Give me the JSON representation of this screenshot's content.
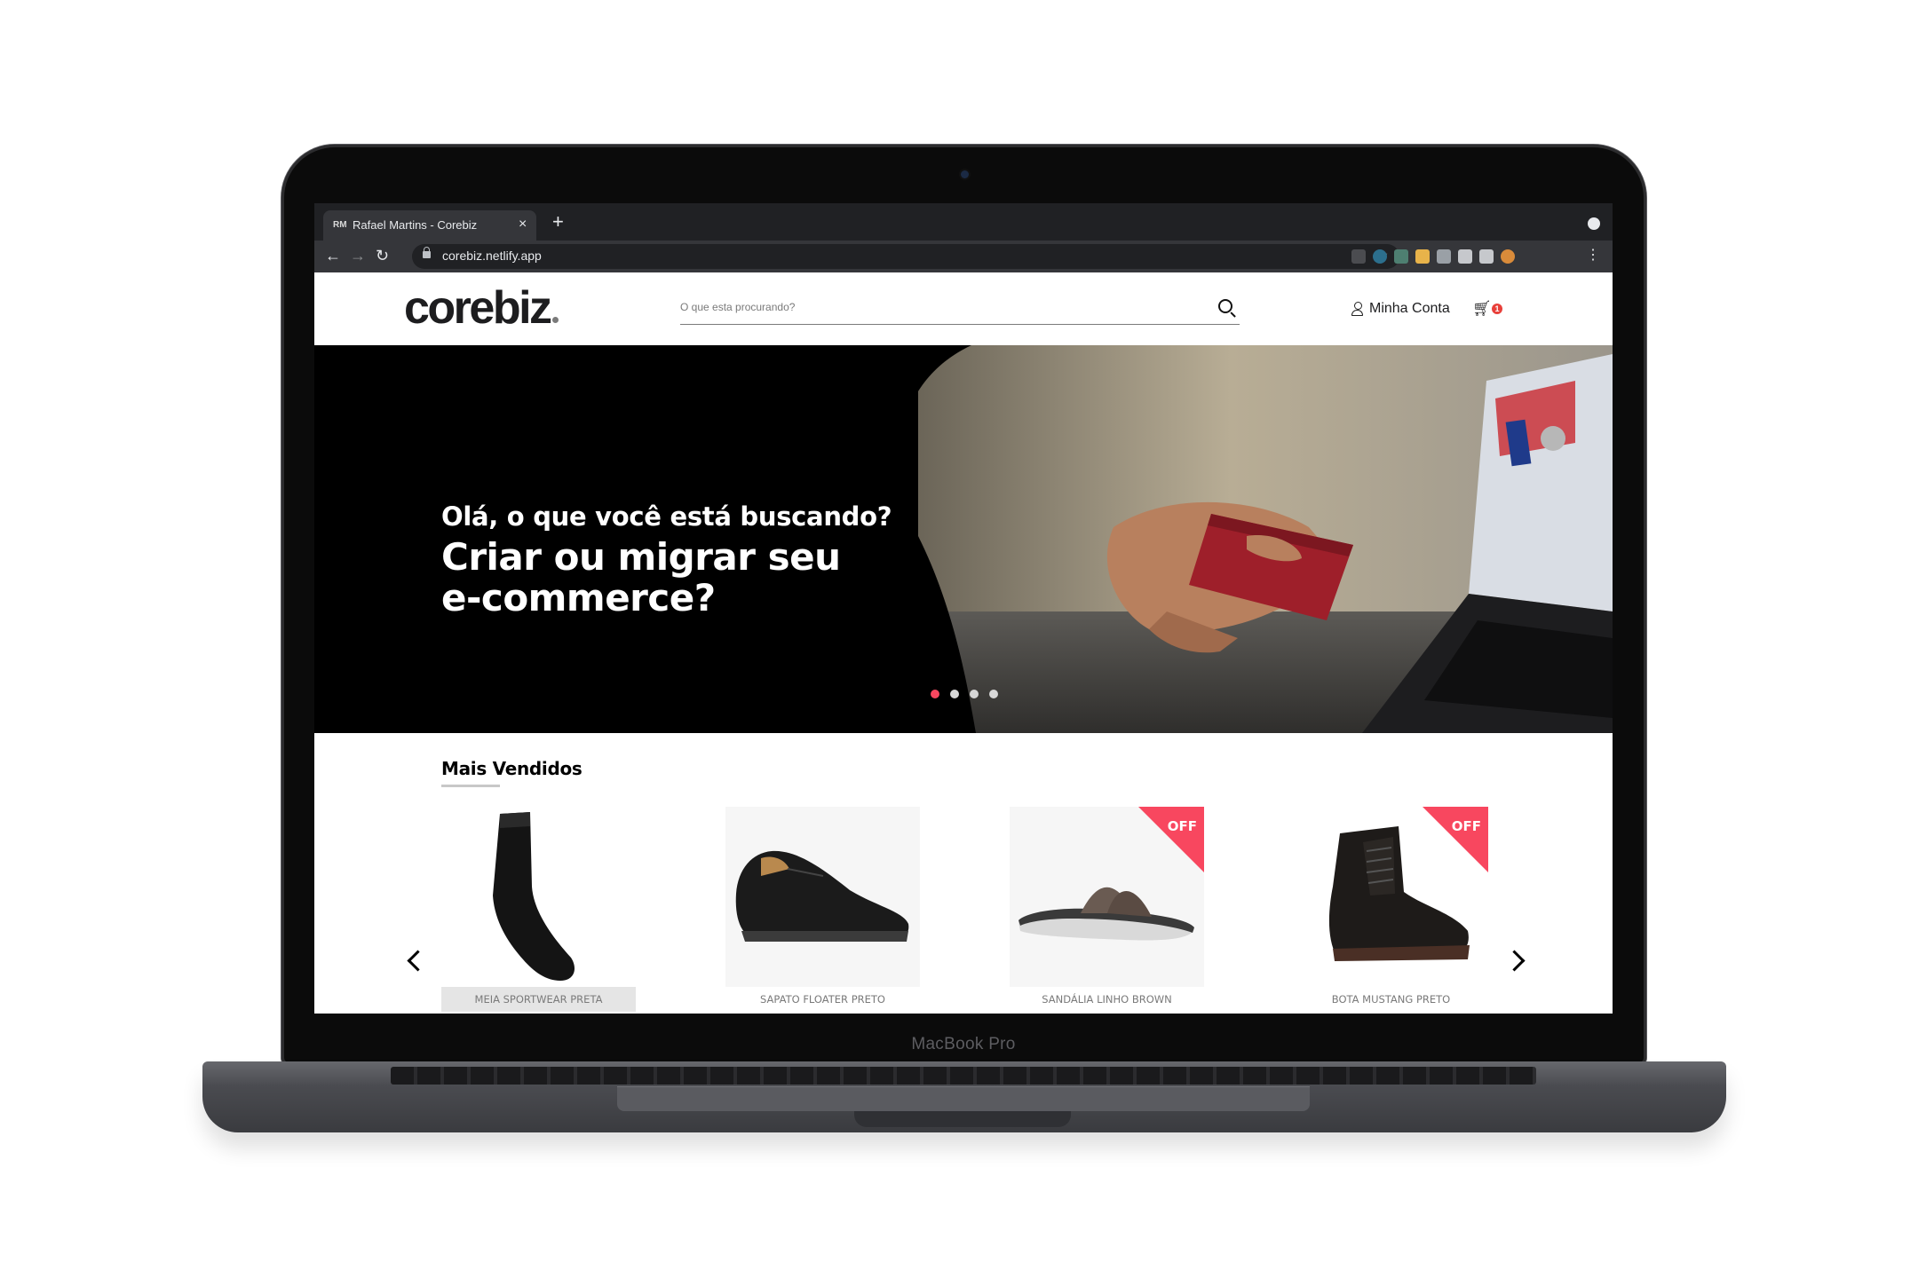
{
  "device": {
    "model_label": "MacBook Pro"
  },
  "browser": {
    "tab_title": "Rafael Martins - Corebiz",
    "tab_favicon": "RM",
    "url": "corebiz.netlify.app",
    "icons": [
      "back-icon",
      "forward-icon",
      "reload-icon",
      "lock-icon",
      "star-icon",
      "extensions-icon",
      "profile-avatar"
    ]
  },
  "header": {
    "logo": "corebiz",
    "search_placeholder": "O que esta procurando?",
    "account_label": "Minha Conta",
    "cart_count": "1"
  },
  "hero": {
    "line1": "Olá, o que você está buscando?",
    "line2": "Criar ou migrar seu e-commerce?",
    "slides": 4,
    "active_slide": 1
  },
  "best_sellers": {
    "title": "Mais Vendidos",
    "products": [
      {
        "name": "MEIA SPORTWEAR PRETA",
        "off": false
      },
      {
        "name": "SAPATO FLOATER PRETO",
        "off": false
      },
      {
        "name": "SANDÁLIA LINHO BROWN",
        "off": true,
        "off_label": "OFF"
      },
      {
        "name": "BOTA MUSTANG PRETO",
        "off": true,
        "off_label": "OFF"
      }
    ]
  },
  "colors": {
    "accent": "#f8475f",
    "dark": "#000000",
    "browser_chrome": "#35363a"
  }
}
